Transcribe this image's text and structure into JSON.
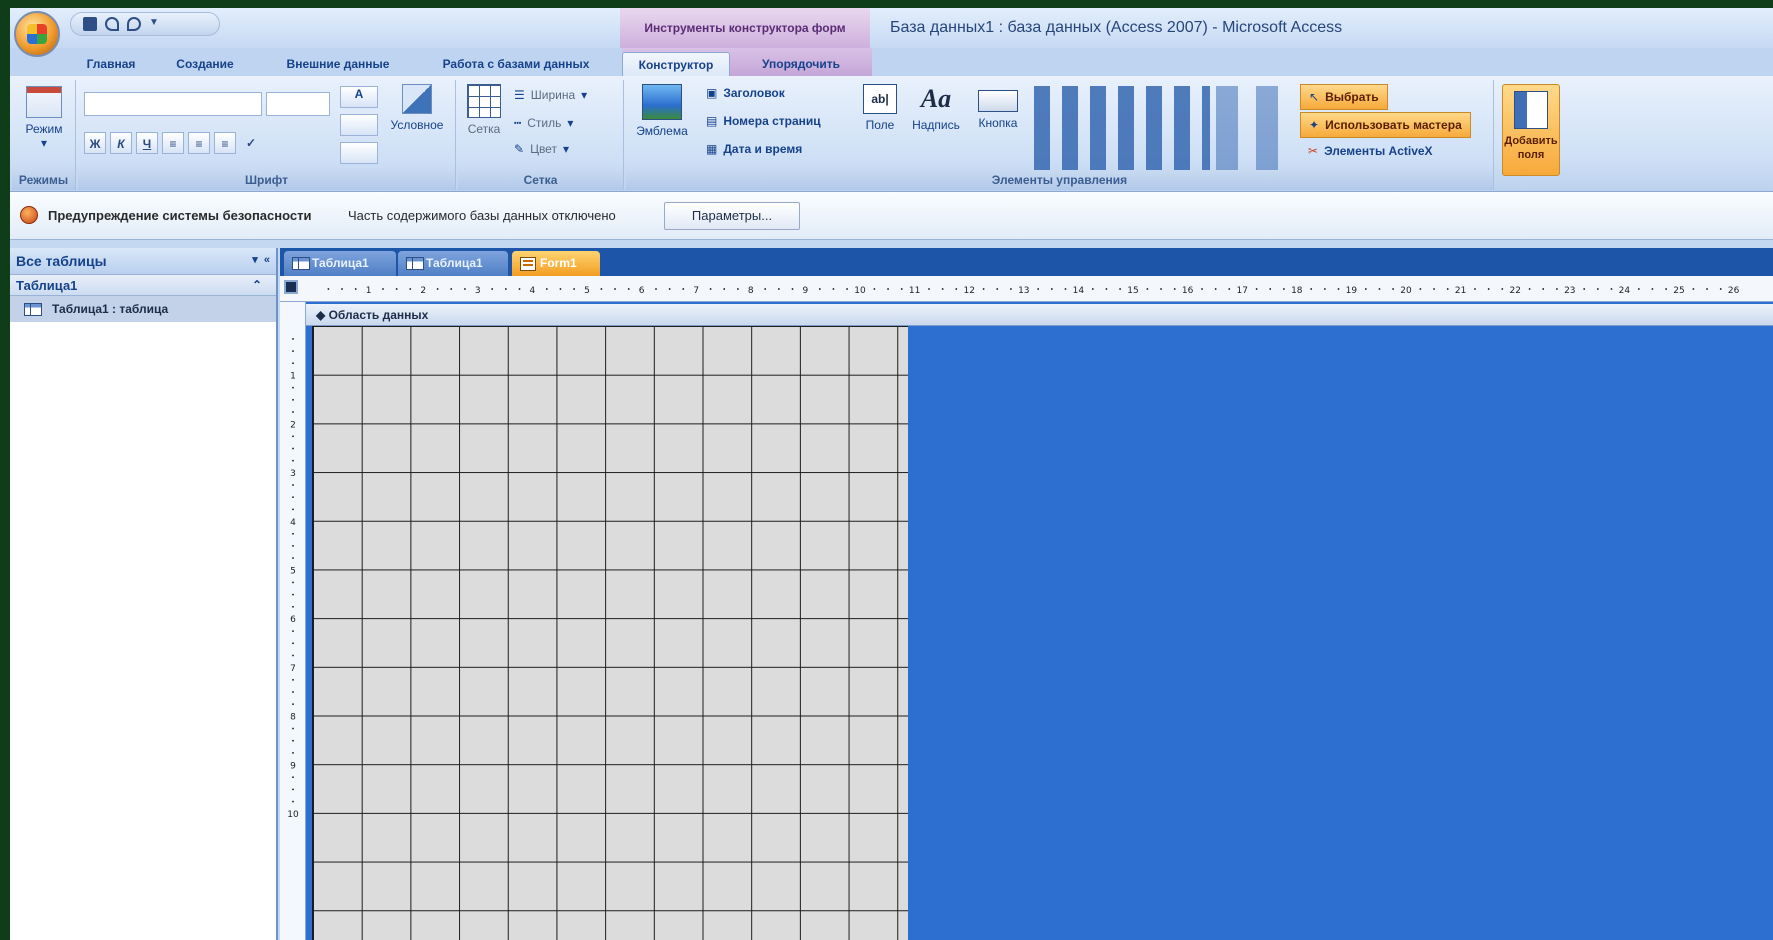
{
  "window": {
    "title": "База данных1 : база данных (Access 2007) - Microsoft Access",
    "contextual_tools": "Инструменты конструктора форм"
  },
  "ribbon_tabs": [
    "Главная",
    "Создание",
    "Внешние данные",
    "Работа с базами данных",
    "Конструктор",
    "Упорядочить"
  ],
  "active_tab": "Конструктор",
  "groups": {
    "views": {
      "label": "Режимы",
      "mode_button": "Режим"
    },
    "font": {
      "label": "Шрифт",
      "conditional": "Условное",
      "format_buttons": [
        "Ж",
        "К",
        "Ч"
      ]
    },
    "grid": {
      "label": "Сетка",
      "grid_button": "Сетка",
      "width": "Ширина",
      "style": "Стиль",
      "color": "Цвет"
    },
    "header_footer": {
      "logo": "Эмблема",
      "title": "Заголовок",
      "page_numbers": "Номера страниц",
      "date_time": "Дата и время"
    },
    "controls": {
      "label": "Элементы управления",
      "field": "Поле",
      "label_ctrl": "Надпись",
      "button": "Кнопка",
      "select": "Выбрать",
      "use_wizards": "Использовать мастера",
      "activex": "Элементы ActiveX"
    },
    "add_fields": {
      "label": "Добавить поля"
    }
  },
  "security_bar": {
    "title": "Предупреждение системы безопасности",
    "message": "Часть содержимого базы данных отключено",
    "button": "Параметры..."
  },
  "nav": {
    "header": "Все таблицы",
    "group": "Таблица1",
    "item": "Таблица1 : таблица"
  },
  "document_tabs": [
    "Таблица1",
    "Таблица1",
    "Form1"
  ],
  "active_document": "Form1",
  "section": "Область данных",
  "ruler": {
    "h_labels": [
      "1",
      "2",
      "3",
      "4",
      "5",
      "6",
      "7",
      "8",
      "9",
      "10",
      "11",
      "12",
      "13",
      "14",
      "15",
      "16",
      "17",
      "18",
      "19",
      "20",
      "21",
      "22",
      "23",
      "24",
      "25",
      "26"
    ],
    "v_labels": [
      "1",
      "2",
      "3",
      "4",
      "5",
      "6",
      "7",
      "8",
      "9",
      "10"
    ]
  },
  "colors": {
    "accent": "#2c6fd1",
    "highlight": "#f7a93a",
    "ribbon": "#cfe0f6"
  }
}
